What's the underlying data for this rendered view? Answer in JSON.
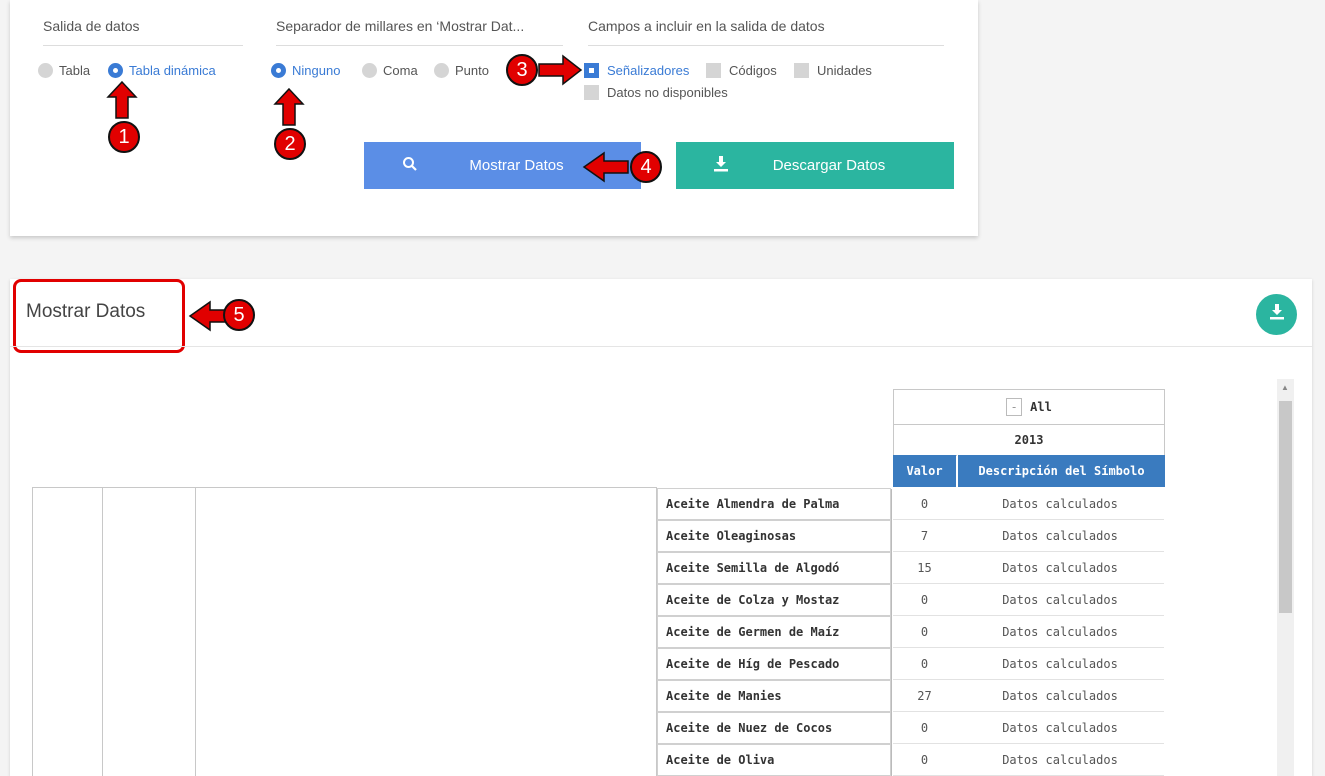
{
  "settings": {
    "output_group": {
      "title": "Salida de datos",
      "options": [
        {
          "label": "Tabla",
          "selected": false
        },
        {
          "label": "Tabla dinámica",
          "selected": true
        }
      ]
    },
    "separator_group": {
      "title": "Separador de millares en ‘Mostrar Dat...",
      "options": [
        {
          "label": "Ninguno",
          "selected": true
        },
        {
          "label": "Coma",
          "selected": false
        },
        {
          "label": "Punto",
          "selected": false
        }
      ]
    },
    "fields_group": {
      "title": "Campos a incluir en la salida de datos",
      "options": [
        {
          "label": "Señalizadores",
          "checked": true
        },
        {
          "label": "Códigos",
          "checked": false
        },
        {
          "label": "Unidades",
          "checked": false
        },
        {
          "label": "Datos no disponibles",
          "checked": false
        }
      ]
    },
    "buttons": {
      "show_label": "Mostrar Datos",
      "download_label": "Descargar Datos"
    }
  },
  "annotations": [
    "1",
    "2",
    "3",
    "4",
    "5"
  ],
  "colors": {
    "accent_blue": "#3a7bd5",
    "button_blue": "#5b8ee6",
    "teal": "#2bb5a0",
    "annotation_red": "#e10000",
    "table_header_blue": "#3a7bbf"
  },
  "results": {
    "title": "Mostrar Datos",
    "download_icon": "download-icon",
    "pivot": {
      "filter_toggle": "-",
      "filter_label": "All",
      "year": "2013",
      "columns": [
        "Valor",
        "Descripción del Símbolo"
      ],
      "rows": [
        {
          "label": "Aceite Almendra de Palma",
          "valor": "0",
          "desc": "Datos calculados"
        },
        {
          "label": "Aceite Oleaginosas",
          "valor": "7",
          "desc": "Datos calculados"
        },
        {
          "label": "Aceite Semilla de Algodó",
          "valor": "15",
          "desc": "Datos calculados"
        },
        {
          "label": "Aceite de Colza y Mostaz",
          "valor": "0",
          "desc": "Datos calculados"
        },
        {
          "label": "Aceite de Germen de Maíz",
          "valor": "0",
          "desc": "Datos calculados"
        },
        {
          "label": "Aceite de Híg de Pescado",
          "valor": "0",
          "desc": "Datos calculados"
        },
        {
          "label": "Aceite de Manies",
          "valor": "27",
          "desc": "Datos calculados"
        },
        {
          "label": "Aceite de Nuez de Cocos",
          "valor": "0",
          "desc": "Datos calculados"
        },
        {
          "label": "Aceite de Oliva",
          "valor": "0",
          "desc": "Datos calculados"
        }
      ]
    }
  }
}
